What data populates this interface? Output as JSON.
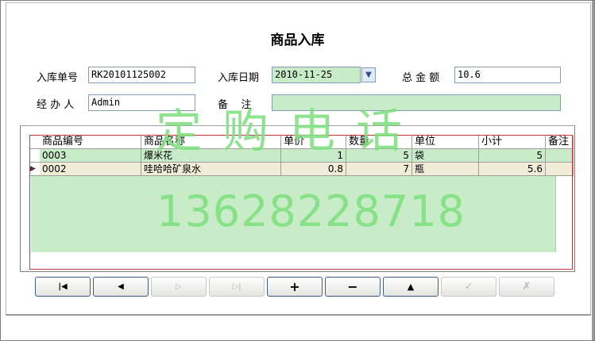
{
  "window": {
    "title": "商品入库"
  },
  "form": {
    "order_no_label": "入库单号",
    "order_no_value": "RK20101125002",
    "date_label": "入库日期",
    "date_value": "2010-11-25",
    "total_label": "总 金 额",
    "total_value": "10.6",
    "handler_label": "经 办 人",
    "handler_value": "Admin",
    "remark_label": "备    注",
    "remark_value": ""
  },
  "grid": {
    "columns": [
      "商品编号",
      "商品名称",
      "单价",
      "数量",
      "单位",
      "小计",
      "备注"
    ],
    "rows": [
      {
        "code": "0003",
        "name": "爆米花",
        "price": "1",
        "qty": "5",
        "unit": "袋",
        "subtotal": "5",
        "remark": ""
      },
      {
        "code": "0002",
        "name": "哇哈哈矿泉水",
        "price": "0.8",
        "qty": "7",
        "unit": "瓶",
        "subtotal": "5.6",
        "remark": ""
      }
    ],
    "current_row_marker": "▶"
  },
  "watermark": {
    "line1": "定购电话",
    "line2": "13628228718"
  },
  "navigator": {
    "buttons": [
      {
        "label": "|◀",
        "icon": "first-record-icon",
        "enabled": true
      },
      {
        "label": "◀",
        "icon": "prior-record-icon",
        "enabled": true
      },
      {
        "label": "▷",
        "icon": "next-record-icon",
        "enabled": false
      },
      {
        "label": "▷|",
        "icon": "last-record-icon",
        "enabled": false
      },
      {
        "label": "+",
        "icon": "insert-icon",
        "enabled": true
      },
      {
        "label": "−",
        "icon": "delete-icon",
        "enabled": true
      },
      {
        "label": "▲",
        "icon": "edit-icon",
        "enabled": true
      },
      {
        "label": "✓",
        "icon": "post-icon",
        "enabled": false
      },
      {
        "label": "✗",
        "icon": "cancel-icon",
        "enabled": false
      }
    ]
  },
  "colors": {
    "accent_green": "#c8ecc8",
    "grid_border_red": "#c43a3a",
    "watermark_green": "#7fe07f"
  }
}
